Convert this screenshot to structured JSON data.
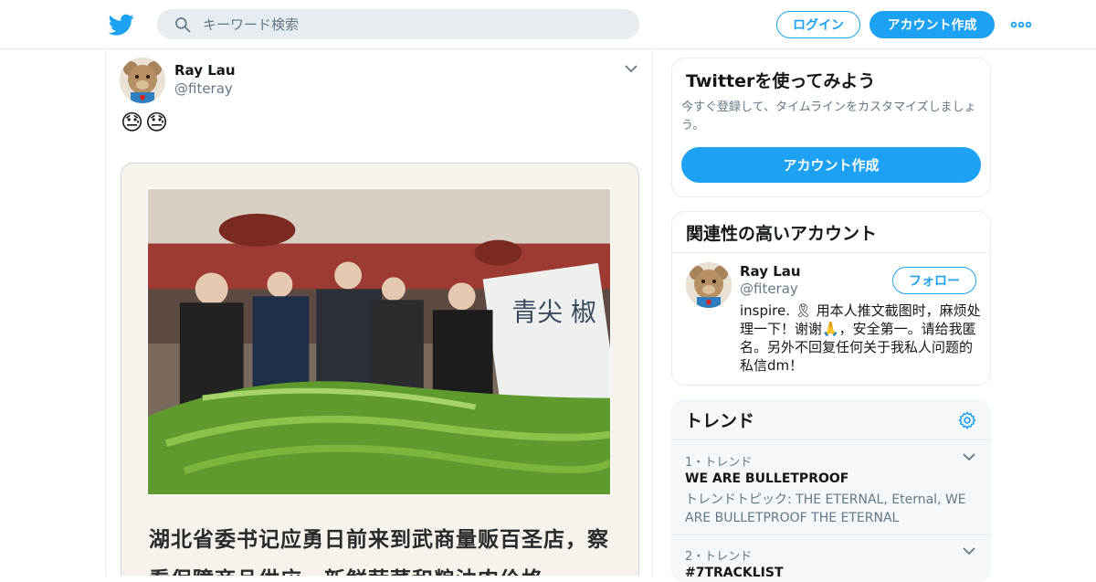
{
  "header": {
    "logo_icon": "twitter-bird-icon",
    "search_placeholder": "キーワード検索",
    "login_label": "ログイン",
    "signup_label": "アカウント作成",
    "more_icon": "more-dots-icon",
    "accent_color": "#1da1f2"
  },
  "tweet": {
    "name": "Ray Lau",
    "handle": "@fiteray",
    "text": "😓😓",
    "caption": "湖北省委书记应勇日前来到武商量贩百圣店，察看保障商品供应，新鲜蔬菜和粮油肉价格"
  },
  "signup_card": {
    "title": "Twitterを使ってみよう",
    "description": "今すぐ登録して、タイムラインをカスタマイズしましょう。",
    "button_label": "アカウント作成"
  },
  "related": {
    "title": "関連性の高いアカウント",
    "name": "Ray Lau",
    "handle": "@fiteray",
    "follow_label": "フォロー",
    "bio": "inspire. 🎗 用本人推文截图时，麻烦处理一下！谢谢🙏，安全第一。请给我匿名。另外不回复任何关于我私人问题的私信dm！"
  },
  "trends": {
    "title": "トレンド",
    "items": [
      {
        "meta": "1・トレンド",
        "name": "WE ARE BULLETPROOF",
        "description": "トレンドトピック: THE ETERNAL, Eternal, WE ARE BULLETPROOF THE ETERNAL"
      },
      {
        "meta": "2・トレンド",
        "name": "#7TRACKLIST",
        "description": ""
      }
    ]
  }
}
